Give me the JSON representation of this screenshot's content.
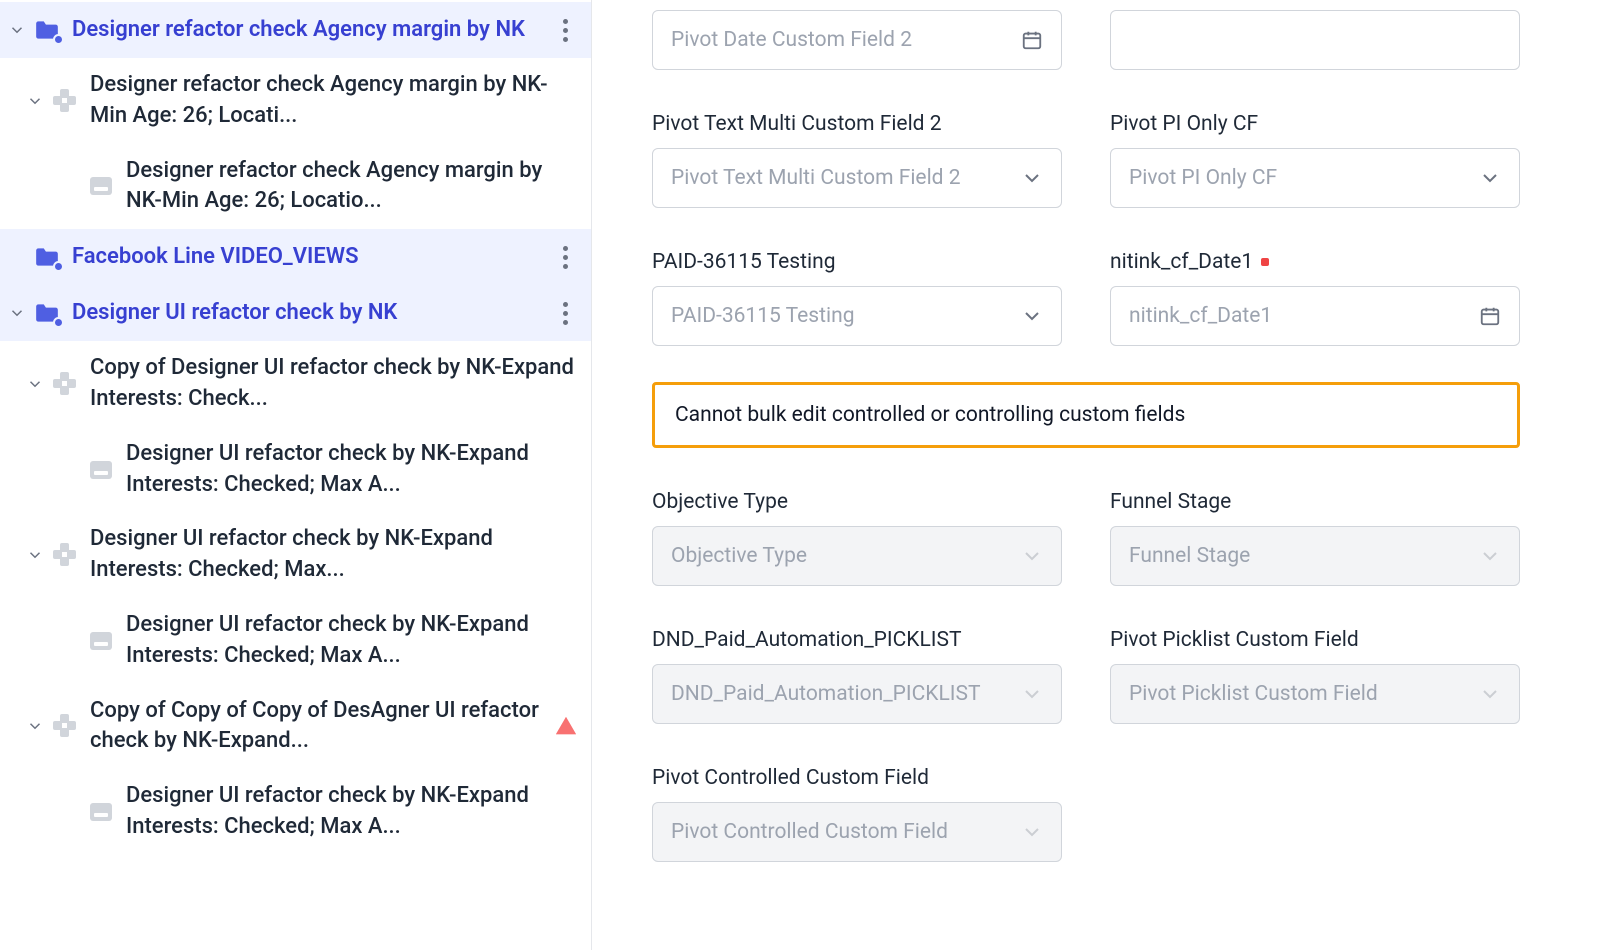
{
  "sidebar": {
    "items": [
      {
        "label": "Designer refactor check Agency margin by NK",
        "type": "folder",
        "highlight": true,
        "caretDown": true,
        "kebab": true
      },
      {
        "label": "Designer refactor check Agency margin by NK-Min Age: 26; Locati...",
        "type": "group",
        "indent": 1,
        "caretDown": true
      },
      {
        "label": "Designer refactor check Agency margin by NK-Min Age: 26; Locatio...",
        "type": "doc",
        "indent": 2
      },
      {
        "label": "Facebook Line VIDEO_VIEWS",
        "type": "folder",
        "highlight": true,
        "kebab": true
      },
      {
        "label": "Designer UI refactor check by NK",
        "type": "folder",
        "highlight": true,
        "caretDown": true,
        "kebab": true
      },
      {
        "label": "Copy of Designer UI refactor check by NK-Expand Interests: Check...",
        "type": "group",
        "indent": 1,
        "caretDown": true
      },
      {
        "label": "Designer UI refactor check by NK-Expand Interests: Checked; Max A...",
        "type": "doc",
        "indent": 2
      },
      {
        "label": "Designer UI refactor check by NK-Expand Interests: Checked; Max...",
        "type": "group",
        "indent": 1,
        "caretDown": true
      },
      {
        "label": "Designer UI refactor check by NK-Expand Interests: Checked; Max A...",
        "type": "doc",
        "indent": 2
      },
      {
        "label": "Copy of Copy of Copy of DesAgner UI refactor check by NK-Expand...",
        "type": "group",
        "indent": 1,
        "caretDown": true,
        "warn": true
      },
      {
        "label": "Designer UI refactor check by NK-Expand Interests: Checked; Max A...",
        "type": "doc",
        "indent": 2
      }
    ]
  },
  "form": {
    "pivot_date_cf2": {
      "placeholder": "Pivot Date Custom Field 2"
    },
    "pivot_text_multi_cf2": {
      "label": "Pivot Text Multi Custom Field 2",
      "placeholder": "Pivot Text Multi Custom Field 2"
    },
    "pivot_pi_only_cf": {
      "label": "Pivot PI Only CF",
      "placeholder": "Pivot PI Only CF"
    },
    "paid_testing": {
      "label": "PAID-36115 Testing",
      "placeholder": "PAID-36115 Testing"
    },
    "nitink_cf_date1": {
      "label": "nitink_cf_Date1",
      "placeholder": "nitink_cf_Date1"
    },
    "warning": "Cannot bulk edit controlled or controlling custom fields",
    "objective_type": {
      "label": "Objective Type",
      "placeholder": "Objective Type"
    },
    "funnel_stage": {
      "label": "Funnel Stage",
      "placeholder": "Funnel Stage"
    },
    "dnd_picklist": {
      "label": "DND_Paid_Automation_PICKLIST",
      "placeholder": "DND_Paid_Automation_PICKLIST"
    },
    "pivot_picklist_cf": {
      "label": "Pivot Picklist Custom Field",
      "placeholder": "Pivot Picklist Custom Field"
    },
    "pivot_controlled_cf": {
      "label": "Pivot Controlled Custom Field",
      "placeholder": "Pivot Controlled Custom Field"
    }
  }
}
